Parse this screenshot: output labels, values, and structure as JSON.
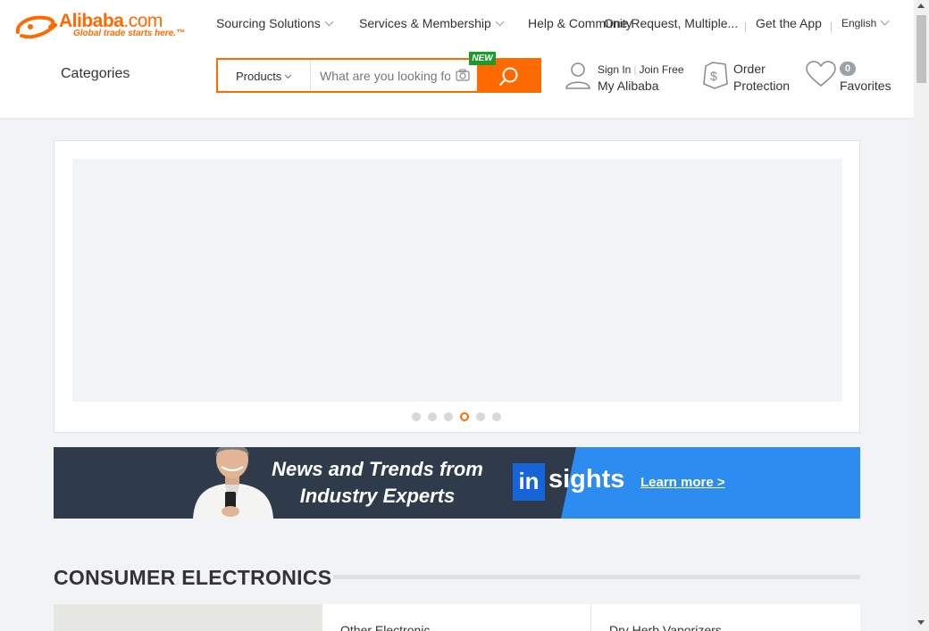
{
  "logo": {
    "brand": "Alibaba",
    "brand_suffix": ".com",
    "tagline": "Global trade starts here.™"
  },
  "topnav": {
    "sourcing": "Sourcing Solutions",
    "services": "Services & Membership",
    "help": "Help & Community",
    "one_request": "One Request, Multiple...",
    "app": "Get the App",
    "language": "English"
  },
  "categories": "Categories",
  "search": {
    "type": "Products",
    "placeholder": "What are you looking for...",
    "new_badge": "NEW"
  },
  "user": {
    "sign_in": "Sign In",
    "join": "Join Free",
    "my": "My Alibaba"
  },
  "order": {
    "line1": "Order",
    "line2": "Protection"
  },
  "favorites": {
    "count": "0",
    "label": "Favorites"
  },
  "carousel": {
    "dot_count": 6,
    "active_dot": 4
  },
  "insights": {
    "news": "News and Trends from Industry Experts",
    "logo_in": "in",
    "logo_rest": "sights",
    "learn_more": "Learn more >"
  },
  "section": {
    "title": "CONSUMER ELECTRONICS",
    "cards": [
      "Other Electronic",
      "Dry Herb Vaporizers"
    ]
  },
  "colors": {
    "accent": "#ff6a00",
    "new_badge": "#1a9c2c",
    "insights_dark": "#2f3a4b",
    "insights_blue": "#2d8cf0"
  }
}
